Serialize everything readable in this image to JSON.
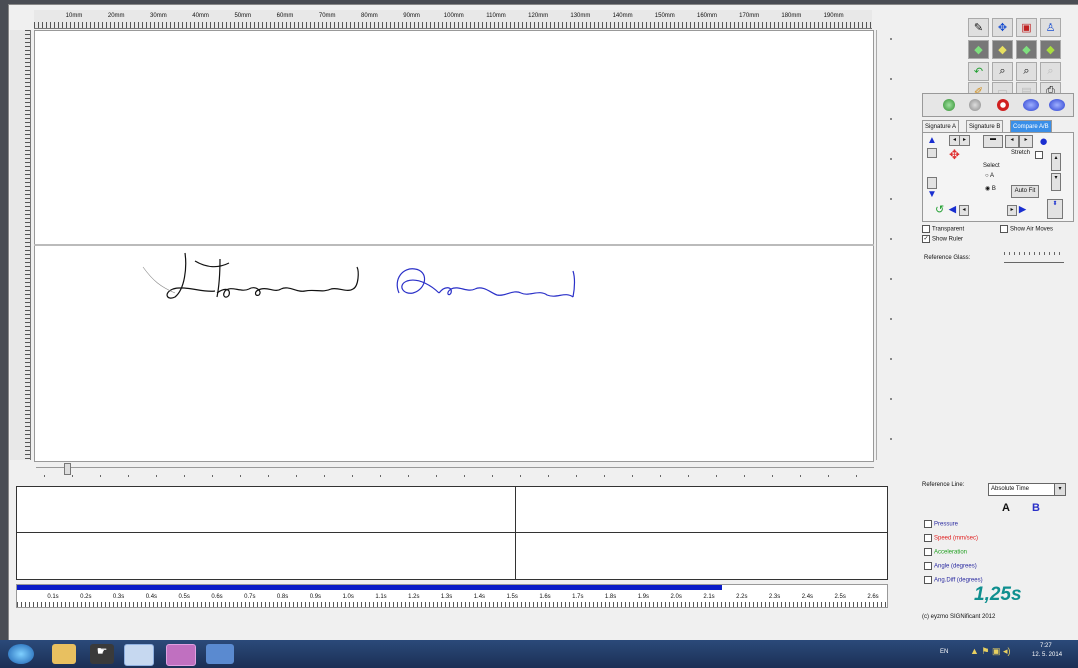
{
  "ruler": {
    "h_labels": [
      "10mm",
      "20mm",
      "30mm",
      "40mm",
      "50mm",
      "60mm",
      "70mm",
      "80mm",
      "90mm",
      "100mm",
      "110mm",
      "120mm",
      "130mm",
      "140mm",
      "150mm",
      "160mm",
      "170mm",
      "180mm",
      "190mm"
    ]
  },
  "toolbar": {
    "icons": [
      "signature-tool-icon",
      "move-icon",
      "clipboard-icon",
      "person-icon",
      "cube-green-icon",
      "cube-yellow-icon",
      "cube-view-icon",
      "cube-light-icon",
      "undo-icon",
      "zoom-in-icon",
      "zoom-out-icon",
      "ghost-icon",
      "pen-icon",
      "open-folder-icon",
      "save-icon",
      "print-icon"
    ]
  },
  "playback": {
    "buttons": [
      "stop-green-icon",
      "stop-grey-icon",
      "record-icon",
      "play-blue-icon",
      "play-blue-2-icon"
    ]
  },
  "tabs": [
    {
      "label": "Signature A",
      "active": false
    },
    {
      "label": "Signature B",
      "active": false
    },
    {
      "label": "Compare A/B",
      "active": true
    }
  ],
  "compare": {
    "stretch_label": "Stretch",
    "select_label": "Select",
    "option_a": "A",
    "option_b": "B",
    "auto_fit_label": "Auto Fit"
  },
  "display_options": {
    "transparent_label": "Transparent",
    "show_air_moves_label": "Show Air Moves",
    "show_ruler_label": "Show Ruler",
    "reference_glass_label": "Reference Glass:"
  },
  "reference": {
    "label": "Reference Line:",
    "selected": "Absolute Time",
    "col_a": "A",
    "col_b": "B"
  },
  "channels": [
    {
      "label": "Pressure",
      "color": "#2a2aa0"
    },
    {
      "label": "Speed (mm/sec)",
      "color": "#e02020"
    },
    {
      "label": "Acceleration",
      "color": "#20a020"
    },
    {
      "label": "Angle (degrees)",
      "color": "#2a2aa0"
    },
    {
      "label": "Ang.Diff (degrees)",
      "color": "#2a2aa0"
    }
  ],
  "time_display": "1,25s",
  "copyright": "(c) eyzmo SIGNificant 2012",
  "timeline": {
    "labels": [
      "0.1s",
      "0.2s",
      "0.3s",
      "0.4s",
      "0.5s",
      "0.6s",
      "0.7s",
      "0.8s",
      "0.9s",
      "1.0s",
      "1.1s",
      "1.2s",
      "1.3s",
      "1.4s",
      "1.5s",
      "1.6s",
      "1.7s",
      "1.8s",
      "1.9s",
      "2.0s",
      "2.1s",
      "2.2s",
      "2.3s",
      "2.4s",
      "2.5s",
      "2.6s"
    ],
    "progress_fraction": 0.81
  },
  "taskbar": {
    "lang": "EN",
    "time": "7:27",
    "date": "12. 5. 2014",
    "apps": [
      "start-orb-icon",
      "file-explorer-icon",
      "media-player-icon",
      "paint-icon",
      "lock-app-icon",
      "signature-app-icon"
    ]
  },
  "colors": {
    "signature_a": "#111111",
    "signature_b": "#2a30c8",
    "progress": "#0a1cc8",
    "time_display": "#0f8f8f"
  }
}
